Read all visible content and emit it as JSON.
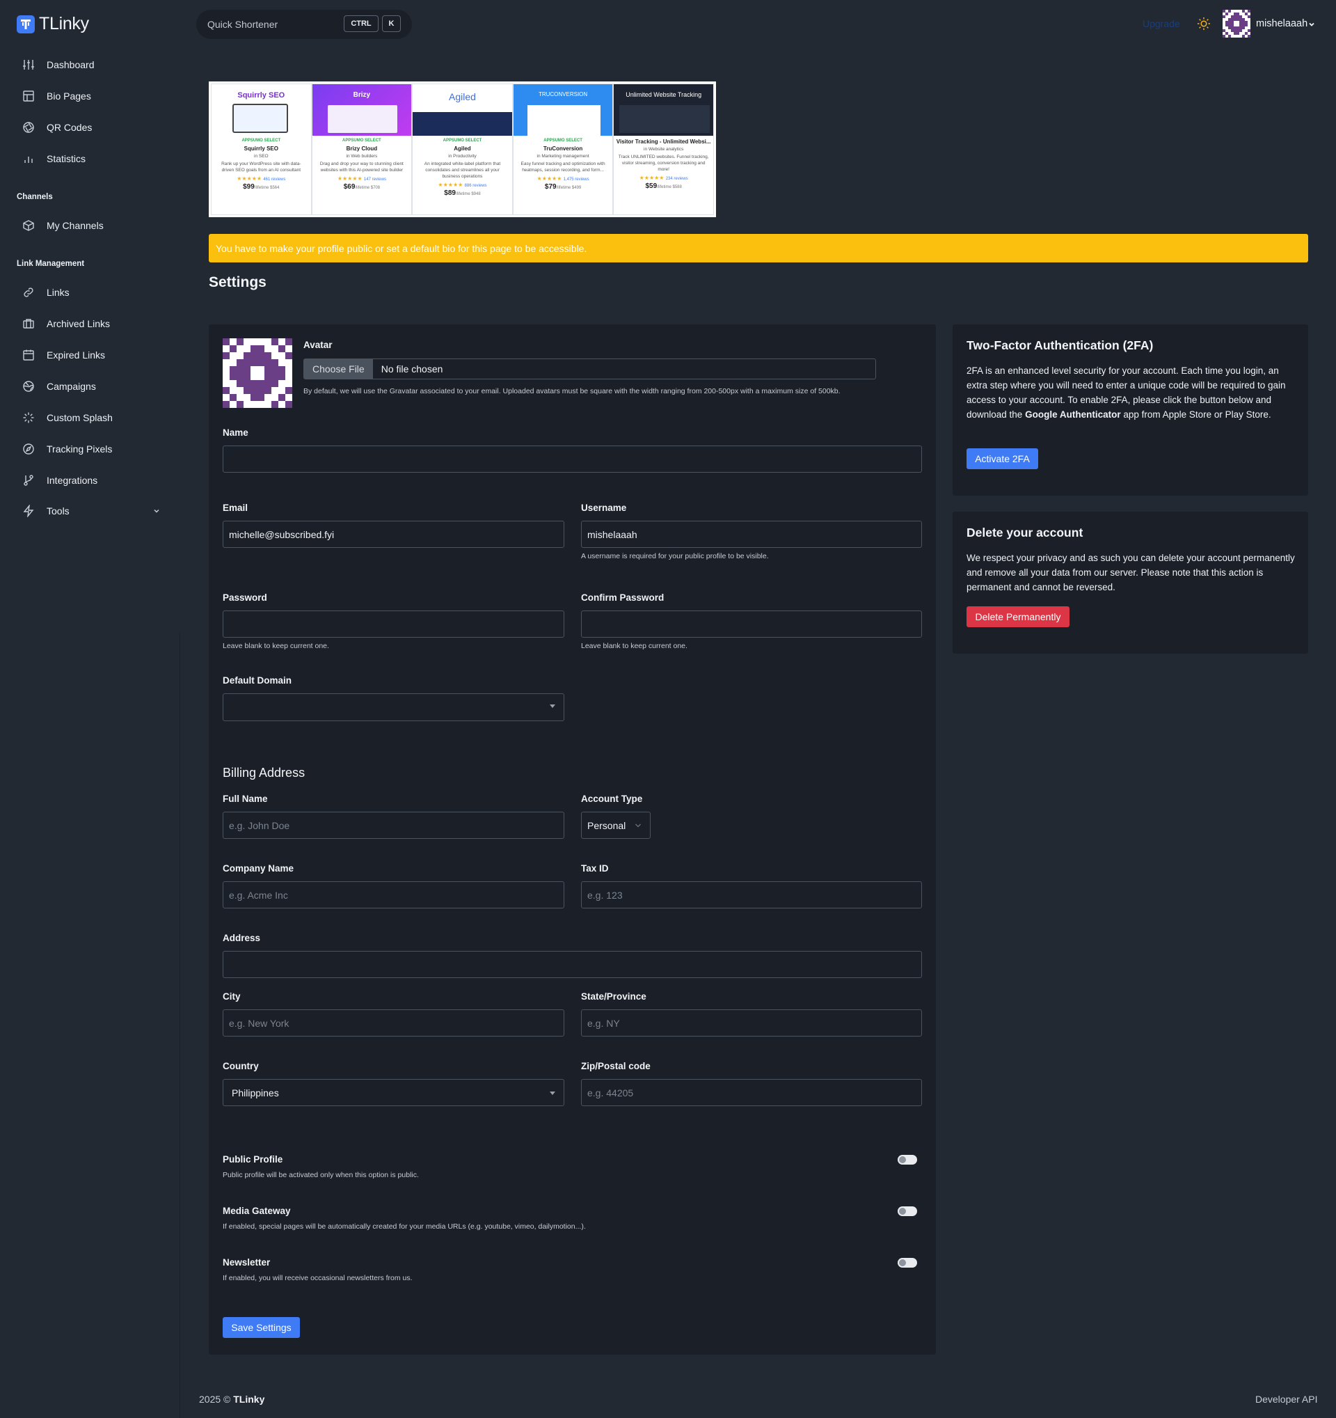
{
  "app": {
    "name": "TLinky"
  },
  "topbar": {
    "search_placeholder": "Quick Shortener",
    "kbd_ctrl": "CTRL",
    "kbd_k": "K",
    "upgrade": "Upgrade",
    "username": "mishelaaah"
  },
  "sidebar": {
    "items": [
      {
        "label": "Dashboard",
        "icon": "sliders-icon"
      },
      {
        "label": "Bio Pages",
        "icon": "layout-icon"
      },
      {
        "label": "QR Codes",
        "icon": "aperture-icon"
      },
      {
        "label": "Statistics",
        "icon": "bar-chart-icon"
      }
    ],
    "section_channels": "Channels",
    "channel_items": [
      {
        "label": "My Channels",
        "icon": "box-icon"
      }
    ],
    "section_links": "Link Management",
    "link_items": [
      {
        "label": "Links",
        "icon": "link-icon"
      },
      {
        "label": "Archived Links",
        "icon": "briefcase-icon"
      },
      {
        "label": "Expired Links",
        "icon": "calendar-icon"
      },
      {
        "label": "Campaigns",
        "icon": "globe-icon"
      },
      {
        "label": "Custom Splash",
        "icon": "loader-icon"
      },
      {
        "label": "Tracking Pixels",
        "icon": "compass-icon"
      },
      {
        "label": "Integrations",
        "icon": "git-branch-icon"
      },
      {
        "label": "Tools",
        "icon": "zap-icon"
      }
    ]
  },
  "ads": [
    {
      "brand": "Squirrly SEO",
      "name": "Squirrly SEO",
      "tag": "APPSUMO SELECT",
      "category": "in SEO",
      "desc": "Rank up your WordPress site with data-driven SEO goals from an AI consultant",
      "reviews": "461 reviews",
      "price": "$99",
      "price_note": "/lifetime $564"
    },
    {
      "brand": "Brizy",
      "name": "Brizy Cloud",
      "tag": "APPSUMO SELECT",
      "category": "in Web builders",
      "desc": "Drag and drop your way to stunning client websites with this AI-powered site builder",
      "reviews": "147 reviews",
      "price": "$69",
      "price_note": "/lifetime $708"
    },
    {
      "brand": "Agiled",
      "name": "Agiled",
      "tag": "APPSUMO SELECT",
      "category": "in Productivity",
      "desc": "An integrated white-label platform that consolidates and streamlines all your business operations",
      "reviews": "886 reviews",
      "price": "$89",
      "price_note": "/lifetime $948"
    },
    {
      "brand": "TRUCONVERSION",
      "name": "TruConversion",
      "tag": "APPSUMO SELECT",
      "category": "in Marketing management",
      "desc": "Easy funnel tracking and optimization with heatmaps, session recording, and form...",
      "reviews": "1,475 reviews",
      "price": "$79",
      "price_note": "/lifetime $499"
    },
    {
      "brand": "Unlimited Website Tracking",
      "name": "Visitor Tracking - Unlimited Websi...",
      "tag": "",
      "category": "in Website analytics",
      "desc": "Track UNLIMITED websites. Funnel tracking, visitor streaming, conversion tracking and more!",
      "reviews": "234 reviews",
      "price": "$59",
      "price_note": "/lifetime $588"
    }
  ],
  "alert": "You have to make your profile public or set a default bio for this page to be accessible.",
  "page_title": "Settings",
  "form": {
    "avatar_label": "Avatar",
    "choose_file": "Choose File",
    "no_file": "No file chosen",
    "avatar_help": "By default, we will use the Gravatar associated to your email. Uploaded avatars must be square with the width ranging from 200-500px with a maximum size of 500kb.",
    "name_label": "Name",
    "name_value": "",
    "email_label": "Email",
    "email_value": "michelle@subscribed.fyi",
    "username_label": "Username",
    "username_value": "mishelaaah",
    "username_help": "A username is required for your public profile to be visible.",
    "password_label": "Password",
    "password_help": "Leave blank to keep current one.",
    "confirm_label": "Confirm Password",
    "confirm_help": "Leave blank to keep current one.",
    "domain_label": "Default Domain",
    "domain_value": "",
    "billing_title": "Billing Address",
    "fullname_label": "Full Name",
    "fullname_ph": "e.g. John Doe",
    "account_type_label": "Account Type",
    "account_type_value": "Personal",
    "company_label": "Company Name",
    "company_ph": "e.g. Acme Inc",
    "tax_label": "Tax ID",
    "tax_ph": "e.g. 123",
    "address_label": "Address",
    "address_value": "",
    "city_label": "City",
    "city_ph": "e.g. New York",
    "state_label": "State/Province",
    "state_ph": "e.g. NY",
    "country_label": "Country",
    "country_value": "Philippines",
    "zip_label": "Zip/Postal code",
    "zip_ph": "e.g. 44205",
    "public_label": "Public Profile",
    "public_help": "Public profile will be activated only when this option is public.",
    "media_label": "Media Gateway",
    "media_help": "If enabled, special pages will be automatically created for your media URLs (e.g. youtube, vimeo, dailymotion...).",
    "news_label": "Newsletter",
    "news_help": "If enabled, you will receive occasional newsletters from us.",
    "save": "Save Settings"
  },
  "twofa": {
    "title": "Two-Factor Authentication (2FA)",
    "text_before": "2FA is an enhanced level security for your account. Each time you login, an extra step where you will need to enter a unique code will be required to gain access to your account. To enable 2FA, please click the button below and download the ",
    "text_bold": "Google Authenticator",
    "text_after": " app from Apple Store or Play Store.",
    "button": "Activate 2FA"
  },
  "delete": {
    "title": "Delete your account",
    "text": "We respect your privacy and as such you can delete your account permanently and remove all your data from our server. Please note that this action is permanent and cannot be reversed.",
    "button": "Delete Permanently"
  },
  "footer": {
    "year": "2025 ©",
    "brand": "TLinky",
    "api": "Developer API"
  },
  "colors": {
    "accent": "#3f7bf4",
    "danger": "#dc3545",
    "warning": "#fbbf0e",
    "bg": "#222933",
    "card": "#1b2028"
  }
}
